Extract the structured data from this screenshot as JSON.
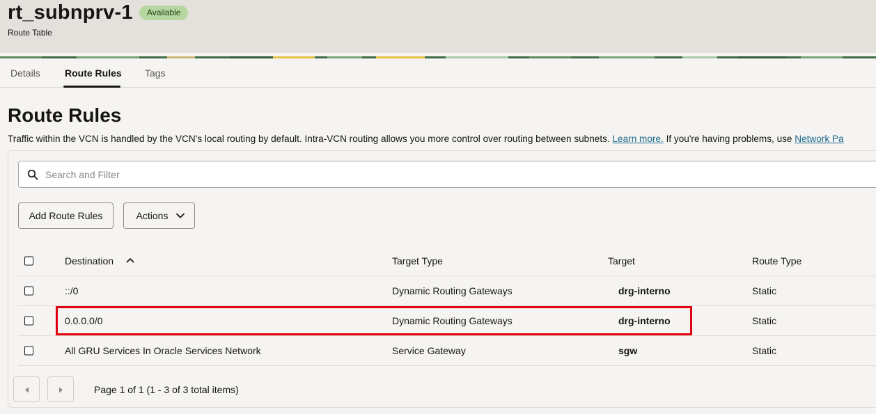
{
  "header": {
    "title": "rt_subnprv-1",
    "status": "Available",
    "subtitle": "Route Table"
  },
  "tabs": [
    {
      "label": "Details"
    },
    {
      "label": "Route Rules",
      "active": true
    },
    {
      "label": "Tags"
    }
  ],
  "section": {
    "title": "Route Rules",
    "description_prefix": "Traffic within the VCN is handled by the VCN's local routing by default. Intra-VCN routing allows you more control over routing between subnets. ",
    "learn_more": "Learn more.",
    "description_mid": " If you're having problems, use ",
    "network_link": "Network Pa"
  },
  "search": {
    "placeholder": "Search and Filter",
    "icon": "search-icon"
  },
  "toolbar": {
    "add_label": "Add Route Rules",
    "actions_label": "Actions"
  },
  "table": {
    "columns": [
      "Destination",
      "Target Type",
      "Target",
      "Route Type"
    ],
    "rows": [
      {
        "destination": "::/0",
        "target_type": "Dynamic Routing Gateways",
        "target": "drg-interno",
        "route_type": "Static"
      },
      {
        "destination": "0.0.0.0/0",
        "target_type": "Dynamic Routing Gateways",
        "target": "drg-interno",
        "route_type": "Static"
      },
      {
        "destination": "All GRU Services In Oracle Services Network",
        "target_type": "Service Gateway",
        "target": "sgw",
        "route_type": "Static"
      }
    ]
  },
  "pagination": {
    "text": "Page 1 of 1 (1 - 3 of 3 total items)"
  },
  "colors": {
    "highlight": "#e1000f",
    "link": "#1e6a8d",
    "badge_bg": "#b7d7a0"
  }
}
